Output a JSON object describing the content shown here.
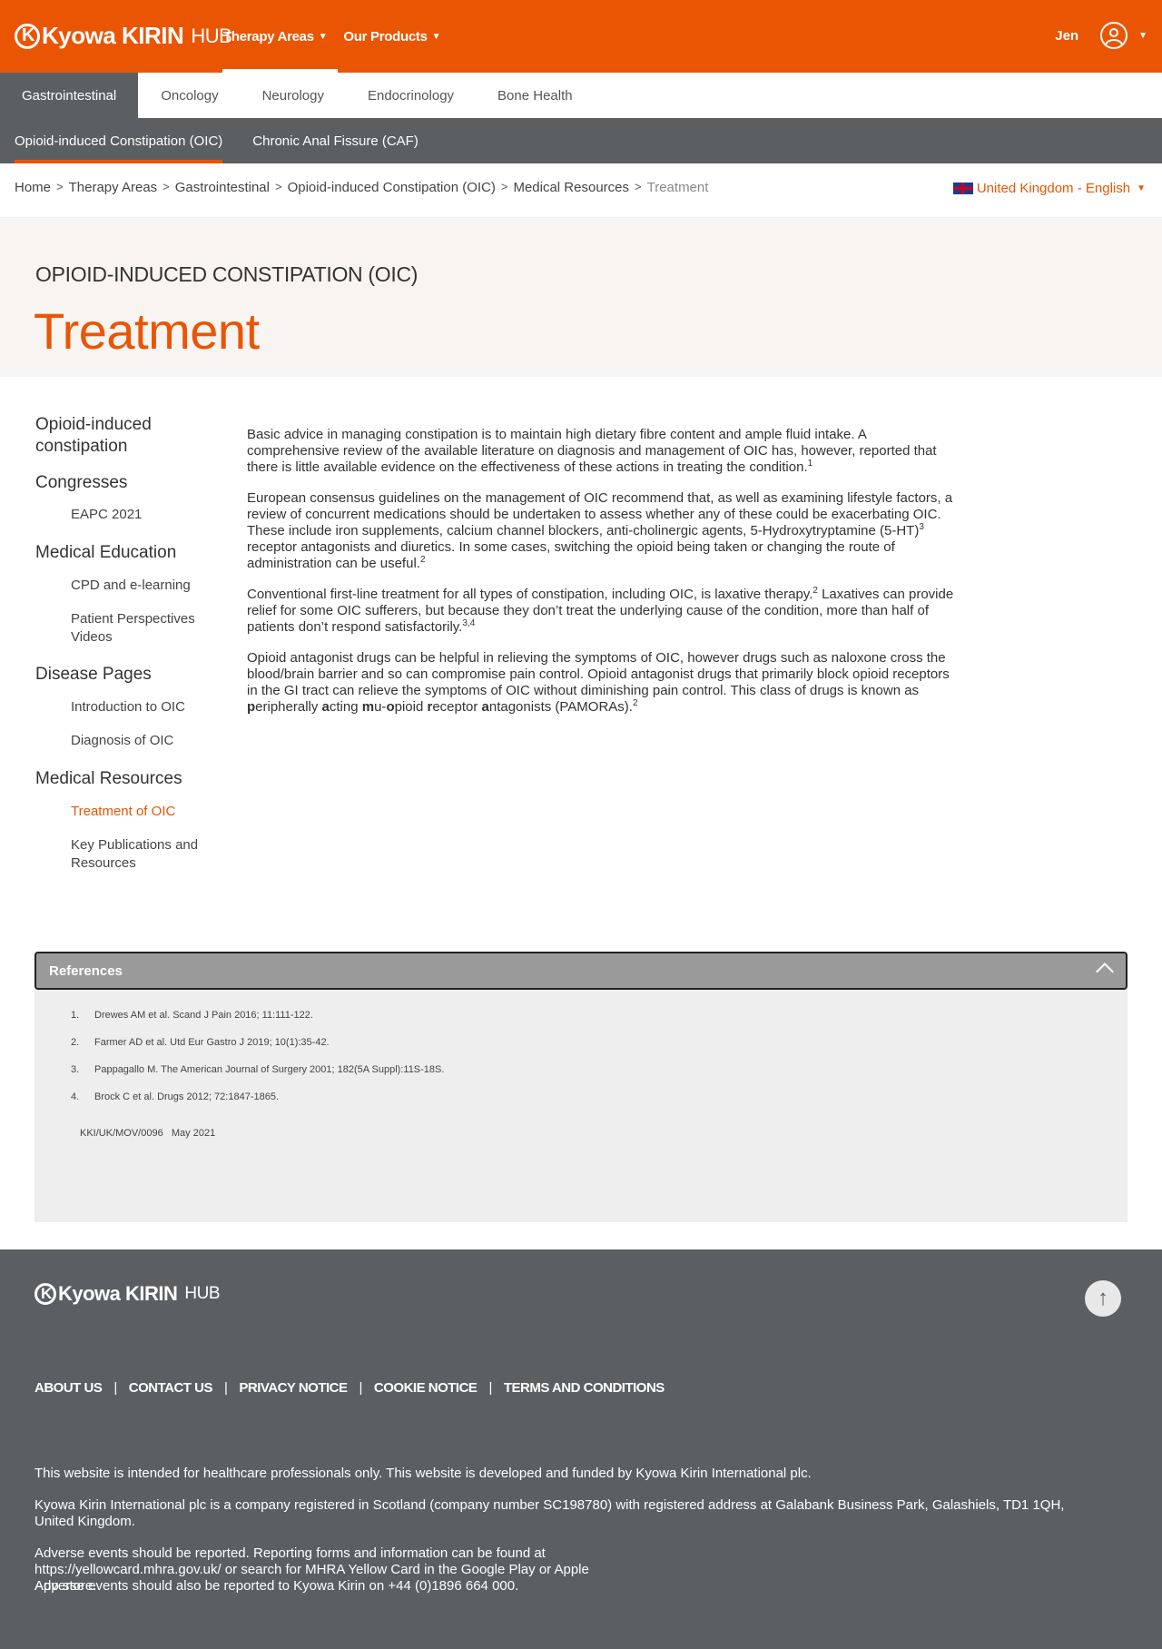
{
  "header": {
    "logo_main": "Kyowa KIRIN",
    "logo_sub": "HUB",
    "nav": [
      {
        "label": "Therapy Areas",
        "caret": "▼"
      },
      {
        "label": "Our Products",
        "caret": "▼"
      }
    ],
    "user_name": "Jen",
    "user_caret": "▼"
  },
  "therapy_tabs": [
    "Gastrointestinal",
    "Oncology",
    "Neurology",
    "Endocrinology",
    "Bone Health"
  ],
  "sub_tabs": [
    "Opioid-induced Constipation (OIC)",
    "Chronic Anal Fissure (CAF)"
  ],
  "breadcrumb": [
    "Home",
    "Therapy Areas",
    "Gastrointestinal",
    "Opioid-induced Constipation (OIC)",
    "Medical Resources",
    "Treatment"
  ],
  "breadcrumb_sep": ">",
  "locale": {
    "label": "United Kingdom - English",
    "caret": "▼"
  },
  "hero": {
    "kicker": "OPIOID-INDUCED CONSTIPATION (OIC)",
    "title": "Treatment"
  },
  "sidenav": {
    "sections": [
      {
        "label": "Opioid-induced constipation",
        "items": []
      },
      {
        "label": "Congresses",
        "items": [
          "EAPC 2021"
        ]
      },
      {
        "label": "Medical Education",
        "items": [
          "CPD and e-learning",
          "Patient Perspectives Videos"
        ]
      },
      {
        "label": "Disease Pages",
        "items": [
          "Introduction to OIC",
          "Diagnosis of OIC"
        ]
      },
      {
        "label": "Medical Resources",
        "items": [
          "Treatment of OIC",
          "Key Publications and Resources"
        ]
      }
    ],
    "current": "Treatment of OIC"
  },
  "article": {
    "p1": "Basic advice in managing constipation is to maintain high dietary fibre content and ample fluid intake. A comprehensive review of the available literature on diagnosis and management of OIC has, however, reported that there is little available evidence on the effectiveness of these actions in treating the condition.",
    "p1_sup": "1",
    "p2a": "European consensus guidelines on the management of OIC recommend that, as well as examining lifestyle factors, a review of concurrent medications should be undertaken to assess whether any of these could be exacerbating OIC. These include iron supplements, calcium channel blockers, anti-cholinergic agents, 5-Hydroxytryptamine (5-HT)",
    "p2a_sup": "3",
    "p2b": " receptor antagonists and diuretics. In some cases, switching the opioid being taken or changing the route of administration can be useful.",
    "p2b_sup": "2",
    "p3a": "Conventional first-line treatment for all types of constipation, including OIC, is laxative therapy.",
    "p3a_sup": "2",
    "p3b": " Laxatives can provide relief for some OIC sufferers, but because they don’t treat the underlying cause of the condition, more than half of patients don’t respond satisfactorily.",
    "p3b_sup": "3,4",
    "p4a": "Opioid antagonist drugs can be helpful in relieving the symptoms of OIC, however drugs such as naloxone cross the blood/brain barrier and so can compromise pain control. Opioid antagonist drugs that primarily block opioid receptors in the GI tract can relieve the symptoms of OIC without diminishing pain control. This class of drugs is known as ",
    "p4_b1": "p",
    "p4_t1": "eripherally ",
    "p4_b2": "a",
    "p4_t2": "cting ",
    "p4_b3": "m",
    "p4_t3": "u-",
    "p4_b4": "o",
    "p4_t4": "pioid ",
    "p4_b5": "r",
    "p4_t5": "eceptor ",
    "p4_b6": "a",
    "p4_t6": "ntagonists (PAMORAs).",
    "p4_sup": "2"
  },
  "references": {
    "title": "References",
    "items": [
      {
        "num": "1.",
        "text": "Drewes AM et al. Scand J Pain 2016; 11:111-122."
      },
      {
        "num": "2.",
        "text": "Farmer AD et al. Utd Eur Gastro J 2019; 10(1):35-42."
      },
      {
        "num": "3.",
        "text": "Pappagallo M. The American Journal of Surgery 2001; 182(5A Suppl):11S-18S."
      },
      {
        "num": "4.",
        "text": "Brock C et al. Drugs 2012; 72:1847-1865."
      }
    ],
    "code": "KKI/UK/MOV/0096   May 2021"
  },
  "footer": {
    "links": [
      "ABOUT US",
      "CONTACT US",
      "PRIVACY NOTICE",
      "COOKIE NOTICE",
      "TERMS AND CONDITIONS"
    ],
    "link_sep": "|",
    "to_top": "↑",
    "note1": "This website is intended for healthcare professionals only. This website is developed and funded by Kyowa Kirin International plc.",
    "note2": "Kyowa Kirin International plc is a company registered in Scotland (company number SC198780) with registered address at Galabank Business Park, Galashiels, TD1 1QH, United Kingdom.",
    "note3": "Adverse events should be reported. Reporting forms and information can be found at https://yellowcard.mhra.gov.uk/ or search for MHRA Yellow Card in the Google Play or Apple App store.",
    "note4": "Adverse events should also be reported to Kyowa Kirin on +44 (0)1896 664 000."
  },
  "colors": {
    "brand_orange": "#ea5504",
    "dark_grey": "#5c5f61",
    "hero_bg": "#f7f4f1"
  }
}
